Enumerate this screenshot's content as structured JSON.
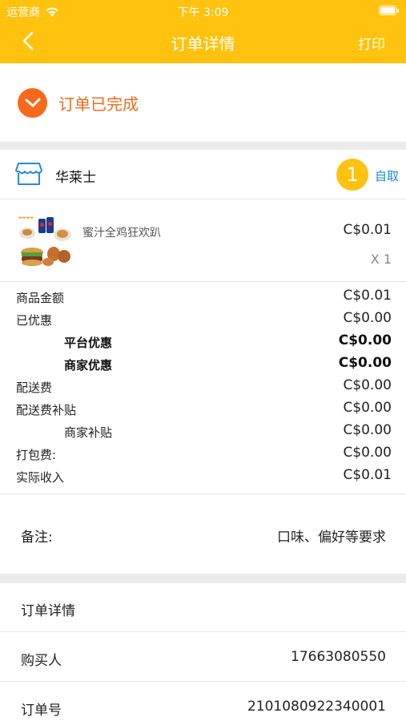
{
  "status_bar": {
    "carrier": "运营商",
    "time": "下午 3:09"
  },
  "nav": {
    "title": "订单详情",
    "print": "打印"
  },
  "order_status": {
    "text": "订单已完成"
  },
  "shop": {
    "name": "华莱士",
    "item_count": "1",
    "delivery_type": "自取"
  },
  "product": {
    "name": "蜜汁全鸡狂欢趴",
    "price": "C$0.01",
    "quantity": "X 1"
  },
  "fees": [
    {
      "label": "商品金额",
      "value": "C$0.01"
    },
    {
      "label": "已优惠",
      "value": "C$0.00"
    },
    {
      "label": "平台优惠",
      "value": "C$0.00"
    },
    {
      "label": "商家优惠",
      "value": "C$0.00"
    },
    {
      "label": "配送费",
      "value": "C$0.00"
    },
    {
      "label": "配送费补贴",
      "value": "C$0.00"
    },
    {
      "label": "商家补贴",
      "value": "C$0.00"
    },
    {
      "label": "打包费:",
      "value": "C$0.00"
    },
    {
      "label": "实际收入",
      "value": "C$0.01"
    }
  ],
  "note": {
    "label": "备注:",
    "value": "口味、偏好等要求"
  },
  "details": {
    "section_title": "订单详情",
    "buyer_label": "购买人",
    "buyer_value": "17663080550",
    "order_no_label": "订单号",
    "order_no_value": "2101080922340001"
  },
  "colors": {
    "accent": "#FFC20E",
    "status_orange": "#F46A1E",
    "link_blue": "#1E88D3"
  }
}
